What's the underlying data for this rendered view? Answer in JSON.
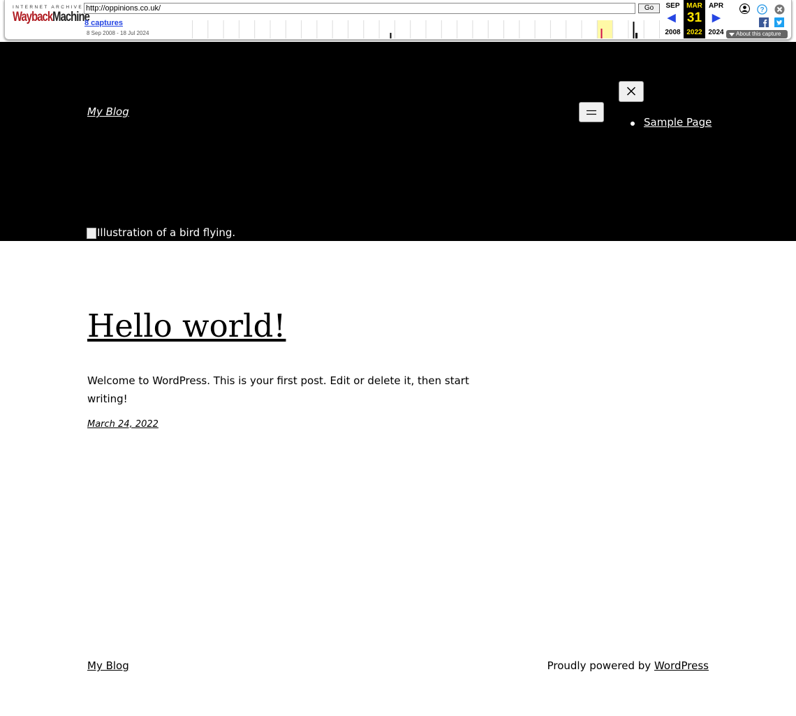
{
  "wayback": {
    "logo_top": "INTERNET ARCHIVE",
    "logo_wayback": "Wayback",
    "logo_machine": "Machine",
    "url": "http://oppinions.co.uk/",
    "go_label": "Go",
    "captures_label": "8 captures",
    "date_range": "8 Sep 2008 - 18 Jul 2024",
    "prev_month": "SEP",
    "prev_year": "2008",
    "current_month": "MAR",
    "current_day": "31",
    "current_year": "2022",
    "next_month": "APR",
    "next_year": "2024",
    "about_label": "About this capture",
    "colors": {
      "link": "#2646e3",
      "highlight": "#ffe600",
      "logo_red": "#b01c22"
    },
    "icons": [
      "user-icon",
      "help-icon",
      "close-icon",
      "facebook-icon",
      "twitter-icon"
    ]
  },
  "header": {
    "site_title": "My Blog",
    "nav_items": [
      {
        "label": "Sample Page"
      }
    ],
    "image_alt": "Illustration of a bird flying."
  },
  "post": {
    "title": "Hello world!",
    "body": "Welcome to WordPress. This is your first post. Edit or delete it, then start writing!",
    "date": "March 24, 2022"
  },
  "footer": {
    "site_title": "My Blog",
    "credit_prefix": "Proudly powered by",
    "credit_link": "WordPress"
  }
}
